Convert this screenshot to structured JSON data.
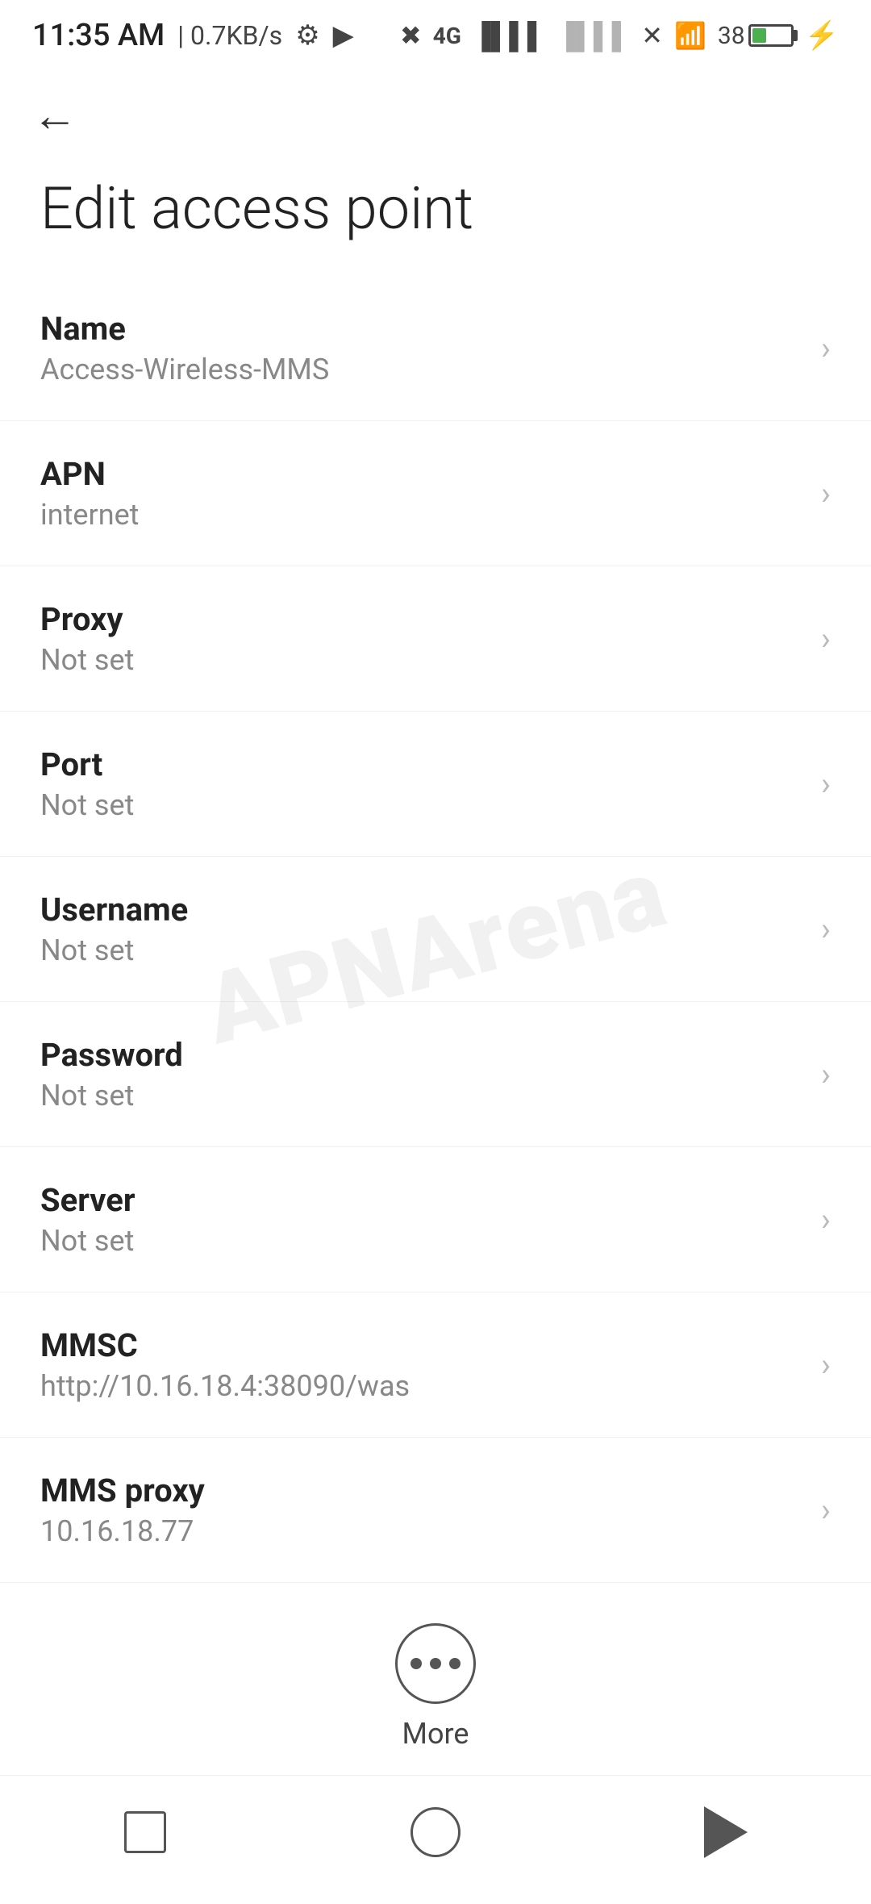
{
  "statusBar": {
    "time": "11:35 AM",
    "speed": "| 0.7KB/s",
    "batteryPercent": "38"
  },
  "header": {
    "backLabel": "←",
    "title": "Edit access point"
  },
  "settings": [
    {
      "label": "Name",
      "value": "Access-Wireless-MMS"
    },
    {
      "label": "APN",
      "value": "internet"
    },
    {
      "label": "Proxy",
      "value": "Not set"
    },
    {
      "label": "Port",
      "value": "Not set"
    },
    {
      "label": "Username",
      "value": "Not set"
    },
    {
      "label": "Password",
      "value": "Not set"
    },
    {
      "label": "Server",
      "value": "Not set"
    },
    {
      "label": "MMSC",
      "value": "http://10.16.18.4:38090/was"
    },
    {
      "label": "MMS proxy",
      "value": "10.16.18.77"
    }
  ],
  "more": {
    "label": "More"
  },
  "watermark": "APNArena"
}
